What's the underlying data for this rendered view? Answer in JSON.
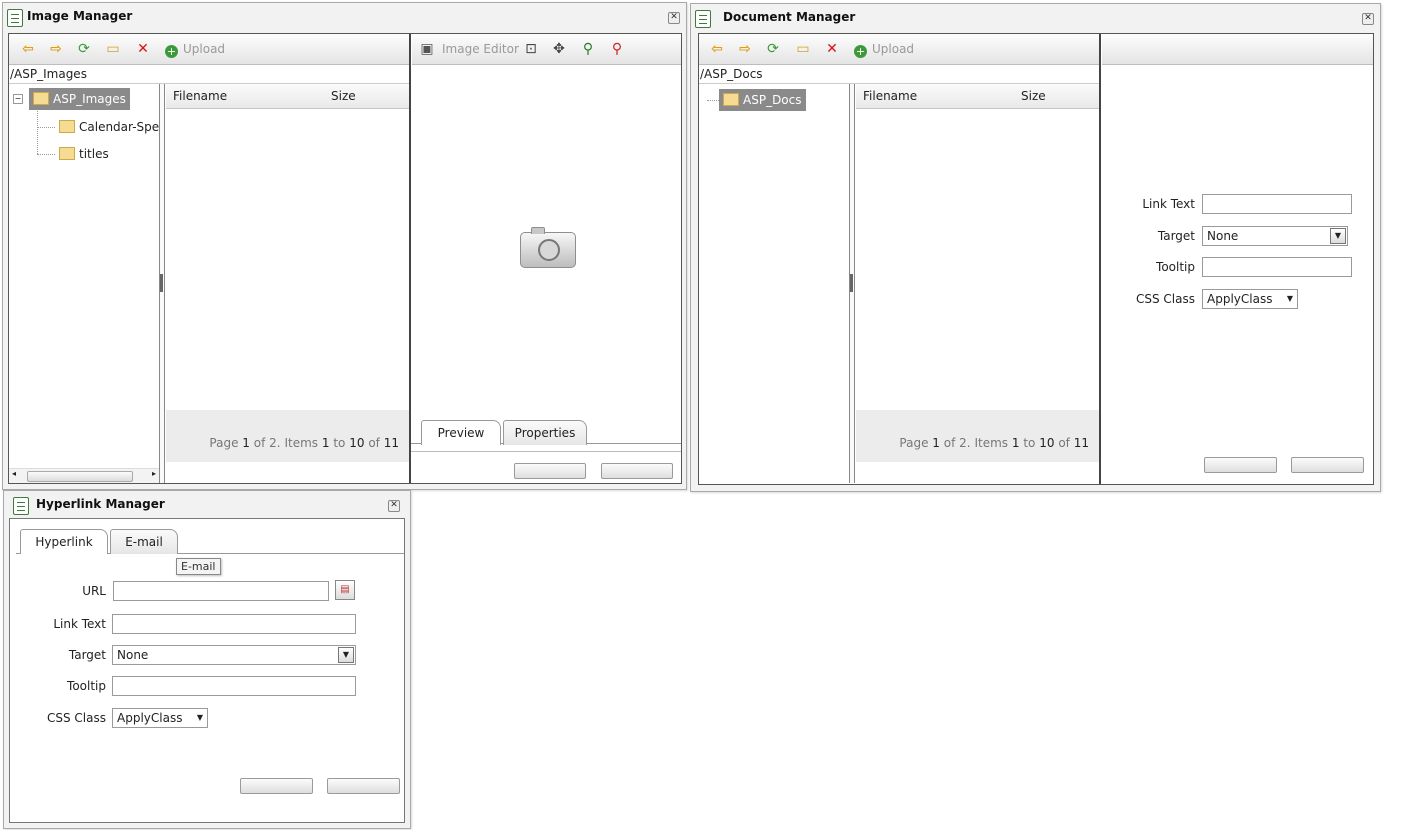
{
  "image_manager": {
    "title": "Image Manager",
    "toolbar": {
      "upload_label": "Upload",
      "image_editor_label": "Image Editor"
    },
    "path": "/ASP_Images",
    "tree": [
      {
        "label": "ASP_Images",
        "selected": true
      },
      {
        "label": "Calendar-Speci"
      },
      {
        "label": "titles"
      }
    ],
    "grid": {
      "col_filename": "Filename",
      "col_size": "Size"
    },
    "pager": {
      "page_word": "Page",
      "page": "1",
      "of_word": "of",
      "pages": "2.",
      "items_word": "Items",
      "from": "1",
      "to_word": "to",
      "to": "10",
      "of2": "of",
      "total": "11"
    },
    "tabs": [
      {
        "label": "Preview"
      },
      {
        "label": "Properties"
      }
    ]
  },
  "document_manager": {
    "title": "Document Manager",
    "toolbar": {
      "upload_label": "Upload"
    },
    "path": "/ASP_Docs",
    "tree": [
      {
        "label": "ASP_Docs",
        "selected": true
      }
    ],
    "grid": {
      "col_filename": "Filename",
      "col_size": "Size"
    },
    "pager": {
      "page_word": "Page",
      "page": "1",
      "of_word": "of",
      "pages": "2.",
      "items_word": "Items",
      "from": "1",
      "to_word": "to",
      "to": "10",
      "of2": "of",
      "total": "11"
    },
    "form": {
      "link_text_label": "Link Text",
      "target_label": "Target",
      "target_value": "None",
      "tooltip_label": "Tooltip",
      "css_class_label": "CSS Class",
      "css_class_value": "ApplyClass"
    }
  },
  "hyperlink_manager": {
    "title": "Hyperlink Manager",
    "tabs": [
      {
        "label": "Hyperlink",
        "active": true
      },
      {
        "label": "E-mail"
      }
    ],
    "tooltip": "E-mail",
    "form": {
      "url_label": "URL",
      "link_text_label": "Link Text",
      "target_label": "Target",
      "target_value": "None",
      "tooltip_label": "Tooltip",
      "css_class_label": "CSS Class",
      "css_class_value": "ApplyClass"
    }
  },
  "icons": {
    "back": "arrow-left-icon",
    "forward": "arrow-right-icon",
    "refresh": "refresh-icon",
    "new_folder": "new-folder-icon",
    "delete": "delete-icon",
    "upload": "upload-icon",
    "folder": "folder-icon",
    "camera": "camera-placeholder-icon",
    "close": "close-icon"
  },
  "colors": {
    "selected_node": "#8a8a8a",
    "upload_plus": "#3c9a3c",
    "delete": "#dd1111",
    "nav_arrow": "#e49b0f"
  }
}
